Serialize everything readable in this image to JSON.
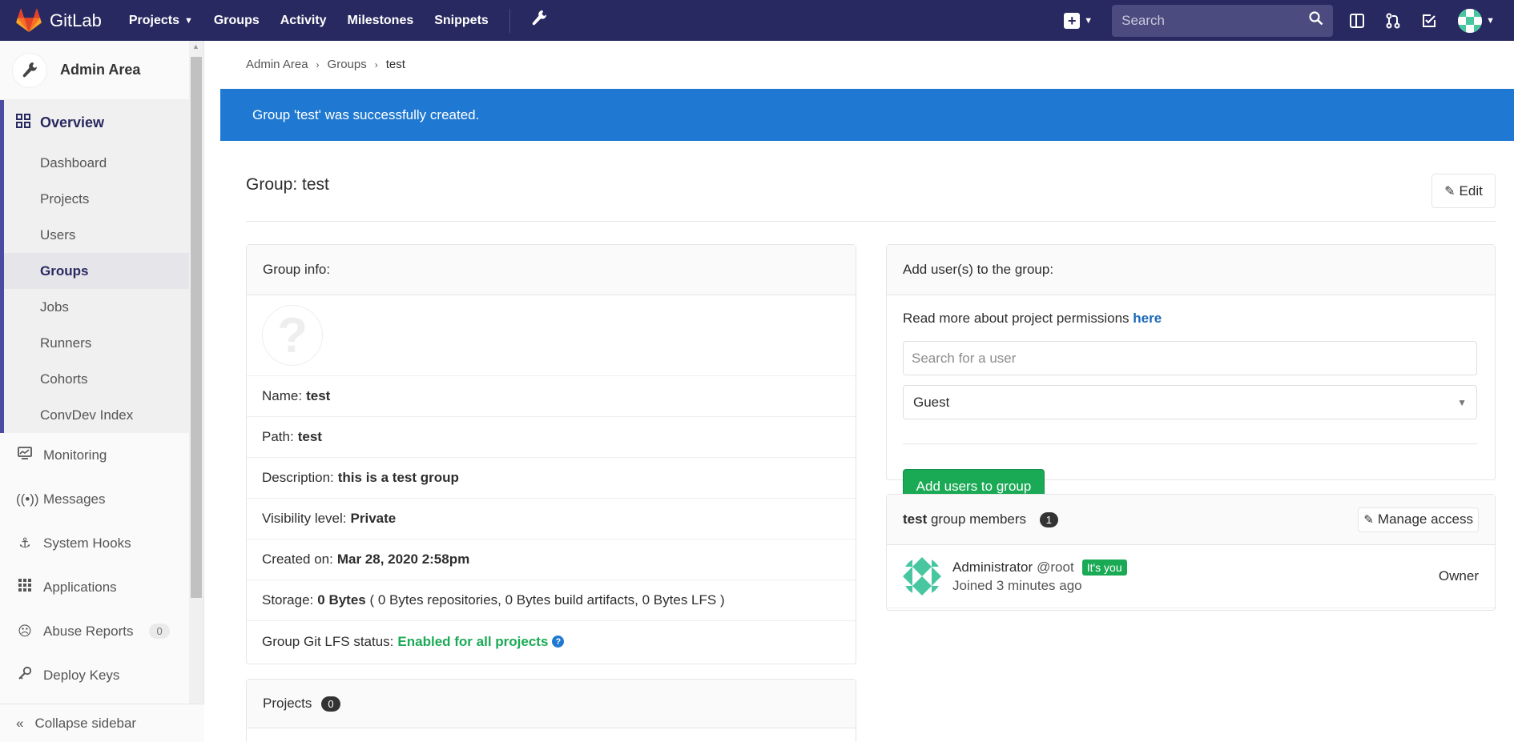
{
  "navbar": {
    "brand": "GitLab",
    "links": [
      {
        "label": "Projects",
        "dropdown": true
      },
      {
        "label": "Groups"
      },
      {
        "label": "Activity"
      },
      {
        "label": "Milestones"
      },
      {
        "label": "Snippets"
      }
    ],
    "search_placeholder": "Search"
  },
  "sidebar": {
    "title": "Admin Area",
    "overview_label": "Overview",
    "overview_items": [
      "Dashboard",
      "Projects",
      "Users",
      "Groups",
      "Jobs",
      "Runners",
      "Cohorts",
      "ConvDev Index"
    ],
    "active_item": "Groups",
    "items": [
      {
        "label": "Monitoring",
        "icon": "monitor-icon"
      },
      {
        "label": "Messages",
        "icon": "broadcast-icon"
      },
      {
        "label": "System Hooks",
        "icon": "anchor-icon"
      },
      {
        "label": "Applications",
        "icon": "grid-icon"
      },
      {
        "label": "Abuse Reports",
        "icon": "frown-icon",
        "badge": "0"
      },
      {
        "label": "Deploy Keys",
        "icon": "key-icon"
      }
    ],
    "collapse_label": "Collapse sidebar"
  },
  "breadcrumb": [
    "Admin Area",
    "Groups",
    "test"
  ],
  "flash": "Group 'test' was successfully created.",
  "page": {
    "title": "Group: test",
    "edit_label": "Edit"
  },
  "group_info": {
    "header": "Group info:",
    "rows": [
      {
        "label": "Name:",
        "value": "test"
      },
      {
        "label": "Path:",
        "value": "test"
      },
      {
        "label": "Description:",
        "value": "this is a test group"
      },
      {
        "label": "Visibility level:",
        "value": "Private"
      },
      {
        "label": "Created on:",
        "value": "Mar 28, 2020 2:58pm"
      }
    ],
    "storage_label": "Storage:",
    "storage_value": "0 Bytes",
    "storage_detail": "( 0 Bytes repositories, 0 Bytes build artifacts, 0 Bytes LFS )",
    "lfs_label": "Group Git LFS status:",
    "lfs_value": "Enabled for all projects"
  },
  "add_users": {
    "header": "Add user(s) to the group:",
    "permissions_text": "Read more about project permissions",
    "permissions_link": "here",
    "search_placeholder": "Search for a user",
    "role": "Guest",
    "button": "Add users to group"
  },
  "members": {
    "group_name": "test",
    "header_suffix": "group members",
    "count": "1",
    "manage_label": "Manage access",
    "list": [
      {
        "name": "Administrator",
        "handle": "@root",
        "badge": "It's you",
        "joined": "Joined 3 minutes ago",
        "role": "Owner"
      }
    ]
  },
  "projects": {
    "header": "Projects",
    "count": "0"
  },
  "colors": {
    "navbar": "#292961",
    "flash": "#1f78d1",
    "success": "#1aaa55"
  }
}
